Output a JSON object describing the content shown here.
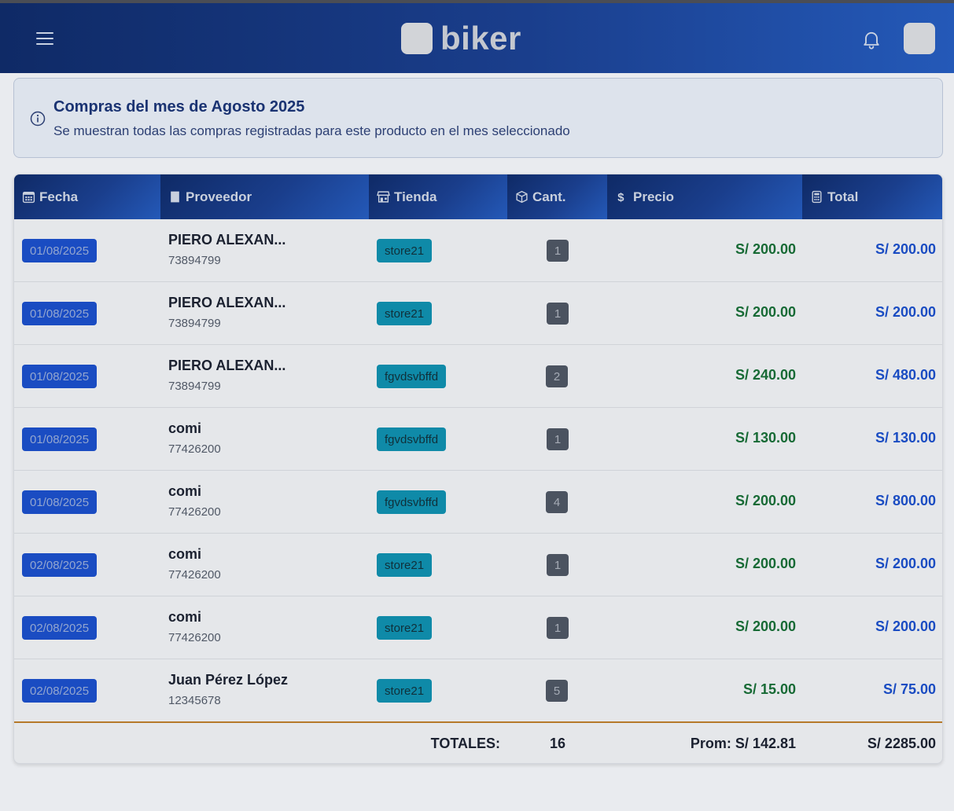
{
  "app": {
    "brand": "biker",
    "menu_icon": "hamburger-icon",
    "notification_icon": "bell-icon"
  },
  "alert": {
    "icon": "info-icon",
    "title": "Compras del mes de Agosto 2025",
    "text": "Se muestran todas las compras registradas para este producto en el mes seleccionado"
  },
  "table": {
    "headers": [
      {
        "label": "Fecha",
        "icon": "calendar-icon"
      },
      {
        "label": "Proveedor",
        "icon": "document-icon"
      },
      {
        "label": "Tienda",
        "icon": "store-icon"
      },
      {
        "label": "Cant.",
        "icon": "box-icon"
      },
      {
        "label": "Precio",
        "icon": "dollar-icon"
      },
      {
        "label": "Total",
        "icon": "calculator-icon"
      }
    ],
    "rows": [
      {
        "date": "01/08/2025",
        "provider": "PIERO ALEXAN...",
        "doc": "73894799",
        "store": "store21",
        "qty": "1",
        "price": "S/ 200.00",
        "total": "S/ 200.00"
      },
      {
        "date": "01/08/2025",
        "provider": "PIERO ALEXAN...",
        "doc": "73894799",
        "store": "store21",
        "qty": "1",
        "price": "S/ 200.00",
        "total": "S/ 200.00"
      },
      {
        "date": "01/08/2025",
        "provider": "PIERO ALEXAN...",
        "doc": "73894799",
        "store": "fgvdsvbffd",
        "qty": "2",
        "price": "S/ 240.00",
        "total": "S/ 480.00"
      },
      {
        "date": "01/08/2025",
        "provider": "comi",
        "doc": "77426200",
        "store": "fgvdsvbffd",
        "qty": "1",
        "price": "S/ 130.00",
        "total": "S/ 130.00"
      },
      {
        "date": "01/08/2025",
        "provider": "comi",
        "doc": "77426200",
        "store": "fgvdsvbffd",
        "qty": "4",
        "price": "S/ 200.00",
        "total": "S/ 800.00"
      },
      {
        "date": "02/08/2025",
        "provider": "comi",
        "doc": "77426200",
        "store": "store21",
        "qty": "1",
        "price": "S/ 200.00",
        "total": "S/ 200.00"
      },
      {
        "date": "02/08/2025",
        "provider": "comi",
        "doc": "77426200",
        "store": "store21",
        "qty": "1",
        "price": "S/ 200.00",
        "total": "S/ 200.00"
      },
      {
        "date": "02/08/2025",
        "provider": "Juan Pérez López",
        "doc": "12345678",
        "store": "store21",
        "qty": "5",
        "price": "S/ 15.00",
        "total": "S/ 75.00"
      }
    ],
    "footer": {
      "label": "TOTALES:",
      "qty": "16",
      "avg": "Prom: S/ 142.81",
      "total": "S/ 2285.00"
    }
  }
}
